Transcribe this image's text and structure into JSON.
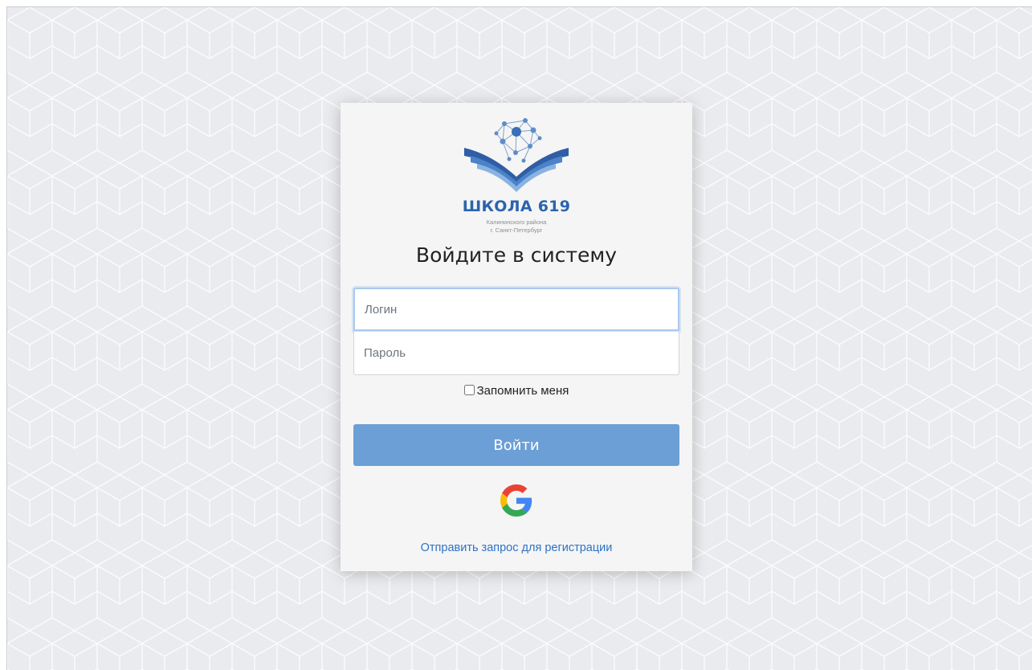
{
  "logo": {
    "title": "ШКОЛА 619",
    "subtitle_line1": "Калининского района",
    "subtitle_line2": "г. Санкт-Петербург"
  },
  "heading": "Войдите в систему",
  "login_field": {
    "value": "",
    "placeholder": "Логин"
  },
  "password_field": {
    "value": "",
    "placeholder": "Пароль"
  },
  "remember": {
    "label": "Запомнить меня",
    "checked": false
  },
  "submit_label": "Войти",
  "google_icon": "google-icon",
  "register_link": "Отправить запрос для регистрации",
  "colors": {
    "button": "#6b9fd6",
    "link": "#2d72c7",
    "brand": "#2b64ad",
    "background": "#e9ebee"
  }
}
